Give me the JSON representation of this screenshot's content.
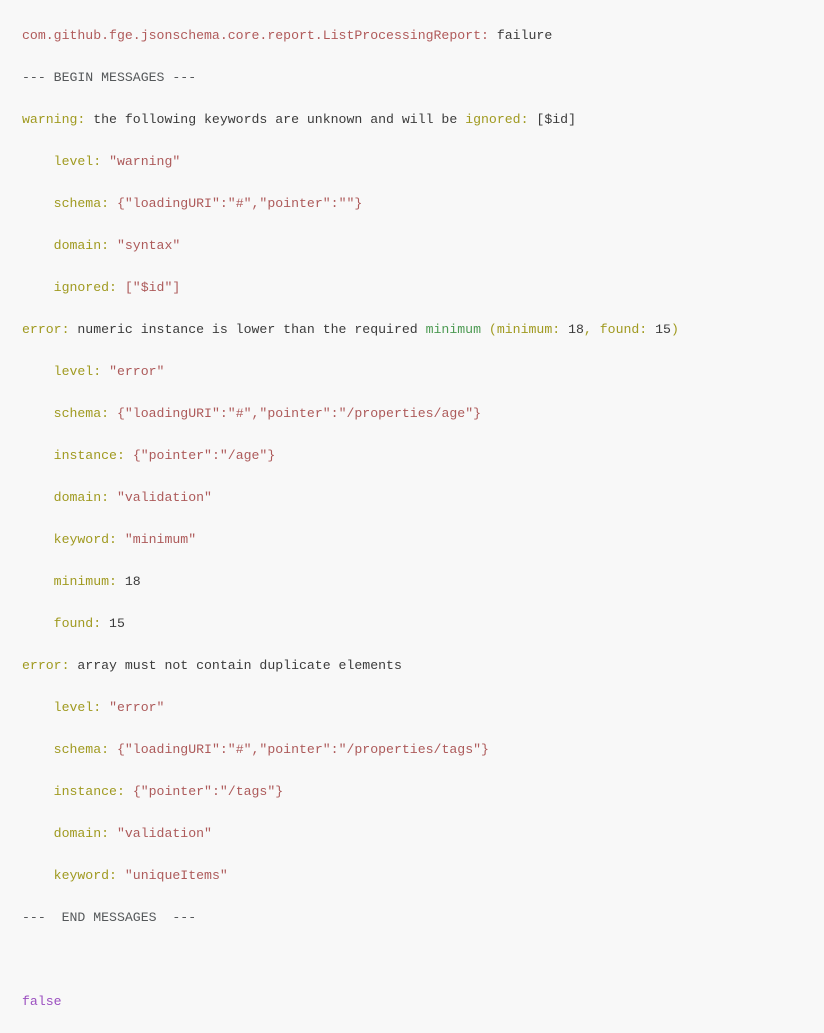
{
  "console": {
    "background_color": "#f8f8f8",
    "default_text_color": "#3b3b3b",
    "colors": {
      "class_path": "#b05a5a",
      "key": "#a09a20",
      "string_value": "#ad5a5a",
      "keyword_green": "#4c9a52",
      "literal_purple": "#9b4fc0",
      "dim": "#55585a"
    },
    "lines": [
      {
        "id": "report-header",
        "segments": [
          {
            "text": "com.github.fge.jsonschema.core.report.ListProcessingReport:",
            "style": "class"
          },
          {
            "text": " failure",
            "style": "plain"
          }
        ]
      },
      {
        "id": "begin-messages",
        "segments": [
          {
            "text": "--- BEGIN MESSAGES ---",
            "style": "dim"
          }
        ]
      },
      {
        "id": "warning-summary",
        "segments": [
          {
            "text": "warning:",
            "style": "key"
          },
          {
            "text": " the following keywords are unknown and will be ",
            "style": "plain"
          },
          {
            "text": "ignored:",
            "style": "key"
          },
          {
            "text": " [$id]",
            "style": "plain"
          }
        ]
      },
      {
        "id": "warning-level",
        "segments": [
          {
            "text": "    ",
            "style": "plain"
          },
          {
            "text": "level:",
            "style": "key"
          },
          {
            "text": " ",
            "style": "plain"
          },
          {
            "text": "\"warning\"",
            "style": "string"
          }
        ]
      },
      {
        "id": "warning-schema",
        "segments": [
          {
            "text": "    ",
            "style": "plain"
          },
          {
            "text": "schema:",
            "style": "key"
          },
          {
            "text": " ",
            "style": "plain"
          },
          {
            "text": "{\"loadingURI\":\"#\",\"pointer\":\"\"}",
            "style": "string"
          }
        ]
      },
      {
        "id": "warning-domain",
        "segments": [
          {
            "text": "    ",
            "style": "plain"
          },
          {
            "text": "domain:",
            "style": "key"
          },
          {
            "text": " ",
            "style": "plain"
          },
          {
            "text": "\"syntax\"",
            "style": "string"
          }
        ]
      },
      {
        "id": "warning-ignored",
        "segments": [
          {
            "text": "    ",
            "style": "plain"
          },
          {
            "text": "ignored:",
            "style": "key"
          },
          {
            "text": " ",
            "style": "plain"
          },
          {
            "text": "[\"$id\"]",
            "style": "string"
          }
        ]
      },
      {
        "id": "error1-summary",
        "segments": [
          {
            "text": "error:",
            "style": "key"
          },
          {
            "text": " numeric instance is lower than the required ",
            "style": "plain"
          },
          {
            "text": "minimum",
            "style": "green"
          },
          {
            "text": " (",
            "style": "key"
          },
          {
            "text": "minimum:",
            "style": "key"
          },
          {
            "text": " 18",
            "style": "plain"
          },
          {
            "text": ",",
            "style": "key"
          },
          {
            "text": " found:",
            "style": "key"
          },
          {
            "text": " 15",
            "style": "plain"
          },
          {
            "text": ")",
            "style": "key"
          }
        ]
      },
      {
        "id": "error1-level",
        "segments": [
          {
            "text": "    ",
            "style": "plain"
          },
          {
            "text": "level:",
            "style": "key"
          },
          {
            "text": " ",
            "style": "plain"
          },
          {
            "text": "\"error\"",
            "style": "string"
          }
        ]
      },
      {
        "id": "error1-schema",
        "segments": [
          {
            "text": "    ",
            "style": "plain"
          },
          {
            "text": "schema:",
            "style": "key"
          },
          {
            "text": " ",
            "style": "plain"
          },
          {
            "text": "{\"loadingURI\":\"#\",\"pointer\":\"/properties/age\"}",
            "style": "string"
          }
        ]
      },
      {
        "id": "error1-instance",
        "segments": [
          {
            "text": "    ",
            "style": "plain"
          },
          {
            "text": "instance:",
            "style": "key"
          },
          {
            "text": " ",
            "style": "plain"
          },
          {
            "text": "{\"pointer\":\"/age\"}",
            "style": "string"
          }
        ]
      },
      {
        "id": "error1-domain",
        "segments": [
          {
            "text": "    ",
            "style": "plain"
          },
          {
            "text": "domain:",
            "style": "key"
          },
          {
            "text": " ",
            "style": "plain"
          },
          {
            "text": "\"validation\"",
            "style": "string"
          }
        ]
      },
      {
        "id": "error1-keyword",
        "segments": [
          {
            "text": "    ",
            "style": "plain"
          },
          {
            "text": "keyword:",
            "style": "key"
          },
          {
            "text": " ",
            "style": "plain"
          },
          {
            "text": "\"minimum\"",
            "style": "string"
          }
        ]
      },
      {
        "id": "error1-minimum",
        "segments": [
          {
            "text": "    ",
            "style": "plain"
          },
          {
            "text": "minimum:",
            "style": "key"
          },
          {
            "text": " 18",
            "style": "plain"
          }
        ]
      },
      {
        "id": "error1-found",
        "segments": [
          {
            "text": "    ",
            "style": "plain"
          },
          {
            "text": "found:",
            "style": "key"
          },
          {
            "text": " 15",
            "style": "plain"
          }
        ]
      },
      {
        "id": "error2-summary",
        "segments": [
          {
            "text": "error:",
            "style": "key"
          },
          {
            "text": " array must not contain duplicate elements",
            "style": "plain"
          }
        ]
      },
      {
        "id": "error2-level",
        "segments": [
          {
            "text": "    ",
            "style": "plain"
          },
          {
            "text": "level:",
            "style": "key"
          },
          {
            "text": " ",
            "style": "plain"
          },
          {
            "text": "\"error\"",
            "style": "string"
          }
        ]
      },
      {
        "id": "error2-schema",
        "segments": [
          {
            "text": "    ",
            "style": "plain"
          },
          {
            "text": "schema:",
            "style": "key"
          },
          {
            "text": " ",
            "style": "plain"
          },
          {
            "text": "{\"loadingURI\":\"#\",\"pointer\":\"/properties/tags\"}",
            "style": "string"
          }
        ]
      },
      {
        "id": "error2-instance",
        "segments": [
          {
            "text": "    ",
            "style": "plain"
          },
          {
            "text": "instance:",
            "style": "key"
          },
          {
            "text": " ",
            "style": "plain"
          },
          {
            "text": "{\"pointer\":\"/tags\"}",
            "style": "string"
          }
        ]
      },
      {
        "id": "error2-domain",
        "segments": [
          {
            "text": "    ",
            "style": "plain"
          },
          {
            "text": "domain:",
            "style": "key"
          },
          {
            "text": " ",
            "style": "plain"
          },
          {
            "text": "\"validation\"",
            "style": "string"
          }
        ]
      },
      {
        "id": "error2-keyword",
        "segments": [
          {
            "text": "    ",
            "style": "plain"
          },
          {
            "text": "keyword:",
            "style": "key"
          },
          {
            "text": " ",
            "style": "plain"
          },
          {
            "text": "\"uniqueItems\"",
            "style": "string"
          }
        ]
      },
      {
        "id": "end-messages",
        "segments": [
          {
            "text": "---  END MESSAGES  ---",
            "style": "dim"
          }
        ]
      },
      {
        "id": "spacer-1",
        "segments": []
      },
      {
        "id": "result-false",
        "segments": [
          {
            "text": "false",
            "style": "purple"
          }
        ]
      }
    ]
  }
}
